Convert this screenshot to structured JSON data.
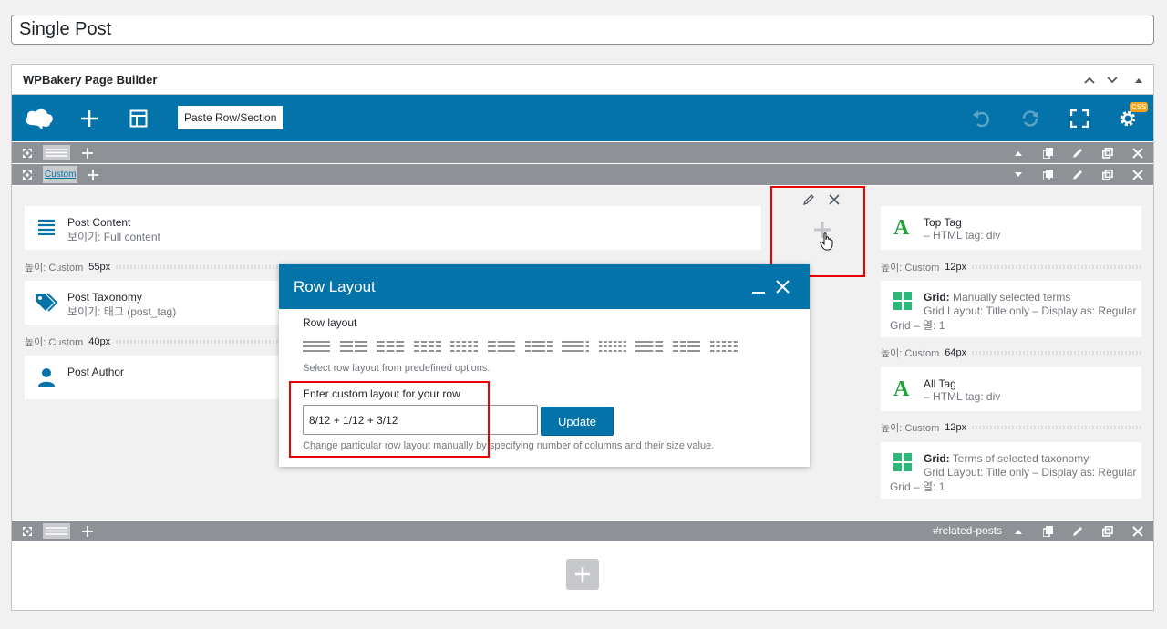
{
  "post_title": "Single Post",
  "builder": {
    "title": "WPBakery Page Builder",
    "paste_button": "Paste Row/Section",
    "css_badge": "CSS",
    "header_controls": [
      "⌃",
      "⌄",
      "▲"
    ]
  },
  "rows": {
    "custom_layout_label": "Custom",
    "related_label": "#related-posts"
  },
  "left_column": {
    "post_content": {
      "title": "Post Content",
      "subtitle": "보이기: Full content"
    },
    "spacer1": {
      "label": "높이: Custom",
      "value": "55px"
    },
    "post_taxonomy": {
      "title": "Post Taxonomy",
      "subtitle": "보이기: 태그 (post_tag)"
    },
    "spacer2": {
      "label": "높이: Custom",
      "value": "40px"
    },
    "post_author": {
      "title": "Post Author"
    }
  },
  "right_column": {
    "top_tag": {
      "title": "Top Tag",
      "subtitle": "– HTML tag: div"
    },
    "spacer1": {
      "label": "높이: Custom",
      "value": "12px"
    },
    "grid1": {
      "title_bold": "Grid:",
      "title_rest": "Manually selected terms",
      "line2": "Grid Layout: Title only – Display as: Regular",
      "line3": "Grid – 열: 1"
    },
    "spacer2": {
      "label": "높이: Custom",
      "value": "64px"
    },
    "all_tag": {
      "title": "All Tag",
      "subtitle": "– HTML tag: div"
    },
    "spacer3": {
      "label": "높이: Custom",
      "value": "12px"
    },
    "grid2": {
      "title_bold": "Grid:",
      "title_rest": "Terms of selected taxonomy",
      "line2": "Grid Layout: Title only – Display as: Regular",
      "line3": "Grid – 열: 1"
    }
  },
  "modal": {
    "title": "Row Layout",
    "row_layout_label": "Row layout",
    "predefined_help": "Select row layout from predefined options.",
    "custom_label": "Enter custom layout for your row",
    "custom_value": "8/12 + 1/12 + 3/12",
    "update_button": "Update",
    "custom_help": "Change particular row layout manually by specifying number of columns and their size value.",
    "layouts": [
      [
        1
      ],
      [
        0.5,
        0.5
      ],
      [
        0.333,
        0.333,
        0.333
      ],
      [
        0.25,
        0.25,
        0.25,
        0.25
      ],
      [
        0.2,
        0.2,
        0.2,
        0.2,
        0.2
      ],
      [
        0.333,
        0.667
      ],
      [
        0.25,
        0.5,
        0.25
      ],
      [
        0.833,
        0.167
      ],
      [
        0.167,
        0.167,
        0.167,
        0.167,
        0.167,
        0.167
      ],
      [
        0.667,
        0.333
      ],
      [
        0.25,
        0.25,
        0.5
      ],
      [
        0.2,
        0.2,
        0.2,
        0.2,
        0.2
      ]
    ]
  },
  "colors": {
    "brand": "#0473aa",
    "bar": "#8e9195",
    "highlight": "#e00000",
    "green": "#22a33a"
  }
}
